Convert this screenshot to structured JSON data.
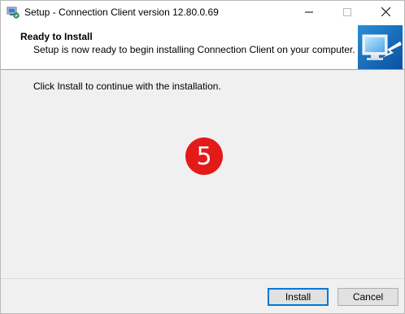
{
  "window": {
    "title": "Setup - Connection Client version 12.80.0.69",
    "app_icon": "installer-icon",
    "controls": [
      "minimize-icon",
      "maximize-icon",
      "close-icon"
    ]
  },
  "header": {
    "title": "Ready to Install",
    "subtitle": "Setup is now ready to begin installing Connection Client on your computer.",
    "image_icon": "computer-install-icon"
  },
  "content": {
    "message": "Click Install to continue with the installation."
  },
  "annotation": {
    "step_number": "5",
    "color": "#e41a1a"
  },
  "buttons": {
    "install_label": "Install",
    "cancel_label": "Cancel"
  },
  "colors": {
    "default_button_border": "#0078d7"
  }
}
